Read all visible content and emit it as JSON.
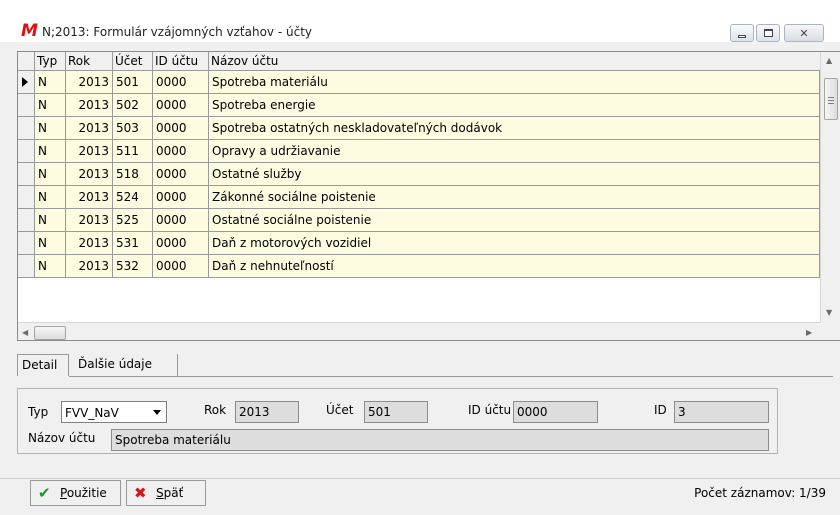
{
  "window": {
    "icon_letter": "M",
    "title": "N;2013:  Formulár vzájomných vzťahov - účty"
  },
  "grid": {
    "columns": [
      "Typ",
      "Rok",
      "Účet",
      "ID účtu",
      "Názov účtu"
    ],
    "rows": [
      {
        "typ": "N",
        "rok": "2013",
        "ucet": "501",
        "id_uctu": "0000",
        "nazov": "Spotreba materiálu"
      },
      {
        "typ": "N",
        "rok": "2013",
        "ucet": "502",
        "id_uctu": "0000",
        "nazov": "Spotreba energie"
      },
      {
        "typ": "N",
        "rok": "2013",
        "ucet": "503",
        "id_uctu": "0000",
        "nazov": "Spotreba ostatných neskladovateľných dodávok"
      },
      {
        "typ": "N",
        "rok": "2013",
        "ucet": "511",
        "id_uctu": "0000",
        "nazov": "Opravy a udržiavanie"
      },
      {
        "typ": "N",
        "rok": "2013",
        "ucet": "518",
        "id_uctu": "0000",
        "nazov": "Ostatné služby"
      },
      {
        "typ": "N",
        "rok": "2013",
        "ucet": "524",
        "id_uctu": "0000",
        "nazov": "Zákonné sociálne poistenie"
      },
      {
        "typ": "N",
        "rok": "2013",
        "ucet": "525",
        "id_uctu": "0000",
        "nazov": "Ostatné sociálne poistenie"
      },
      {
        "typ": "N",
        "rok": "2013",
        "ucet": "531",
        "id_uctu": "0000",
        "nazov": "Daň z motorových vozidiel"
      },
      {
        "typ": "N",
        "rok": "2013",
        "ucet": "532",
        "id_uctu": "0000",
        "nazov": "Daň z nehnuteľností"
      }
    ],
    "row_color": "#fefce0"
  },
  "tabs": [
    {
      "label": "Detail",
      "active": true
    },
    {
      "label": "Ďalšie údaje",
      "active": false
    }
  ],
  "detail": {
    "typ_label": "Typ",
    "typ_value": "FVV_NaV",
    "rok_label": "Rok",
    "rok_value": "2013",
    "ucet_label": "Účet",
    "ucet_value": "501",
    "id_uctu_label": "ID účtu",
    "id_uctu_value": "0000",
    "id_label": "ID",
    "id_value": "3",
    "nazov_label": "Názov účtu",
    "nazov_value": "Spotreba materiálu"
  },
  "footer": {
    "use_button_prefix": "P",
    "use_button_rest": "oužitie",
    "back_button_prefix": "S",
    "back_button_rest": "päť",
    "record_count": "Počet záznamov: 1/39"
  },
  "icons": {
    "check": "check-icon",
    "cross": "x-icon",
    "app": "app-logo-icon"
  }
}
